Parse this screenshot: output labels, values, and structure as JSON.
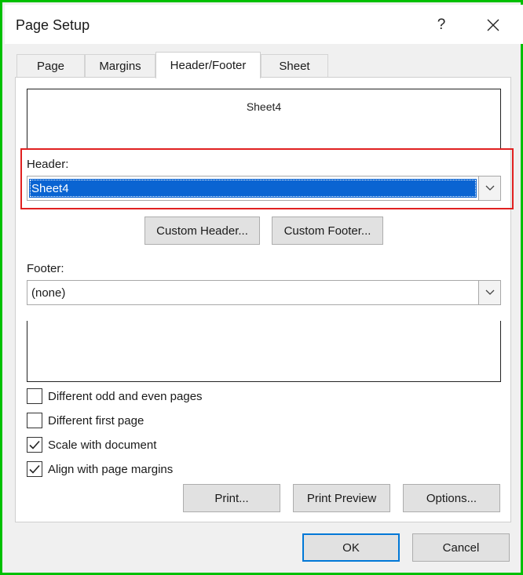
{
  "window": {
    "title": "Page Setup",
    "help_label": "?"
  },
  "tabs": [
    {
      "label": "Page",
      "active": false
    },
    {
      "label": "Margins",
      "active": false
    },
    {
      "label": "Header/Footer",
      "active": true
    },
    {
      "label": "Sheet",
      "active": false
    }
  ],
  "header_preview": {
    "text": "Sheet4"
  },
  "header": {
    "label": "Header:",
    "value": "Sheet4"
  },
  "custom_buttons": {
    "custom_header": "Custom Header...",
    "custom_footer": "Custom Footer..."
  },
  "footer": {
    "label": "Footer:",
    "value": "(none)"
  },
  "footer_preview": {
    "text": ""
  },
  "options": [
    {
      "label": "Different odd and even pages",
      "checked": false
    },
    {
      "label": "Different first page",
      "checked": false
    },
    {
      "label": "Scale with document",
      "checked": true
    },
    {
      "label": "Align with page margins",
      "checked": true
    }
  ],
  "action_buttons": {
    "print": "Print...",
    "print_preview": "Print Preview",
    "options": "Options..."
  },
  "dialog_buttons": {
    "ok": "OK",
    "cancel": "Cancel"
  },
  "colors": {
    "frame_highlight": "#00c000",
    "focus_box": "#e02020",
    "selection": "#0a64d2",
    "default_button_border": "#0078d7"
  },
  "icons": {
    "close": "close-icon",
    "dropdown": "chevron-down-icon",
    "checkmark": "checkmark-icon"
  }
}
